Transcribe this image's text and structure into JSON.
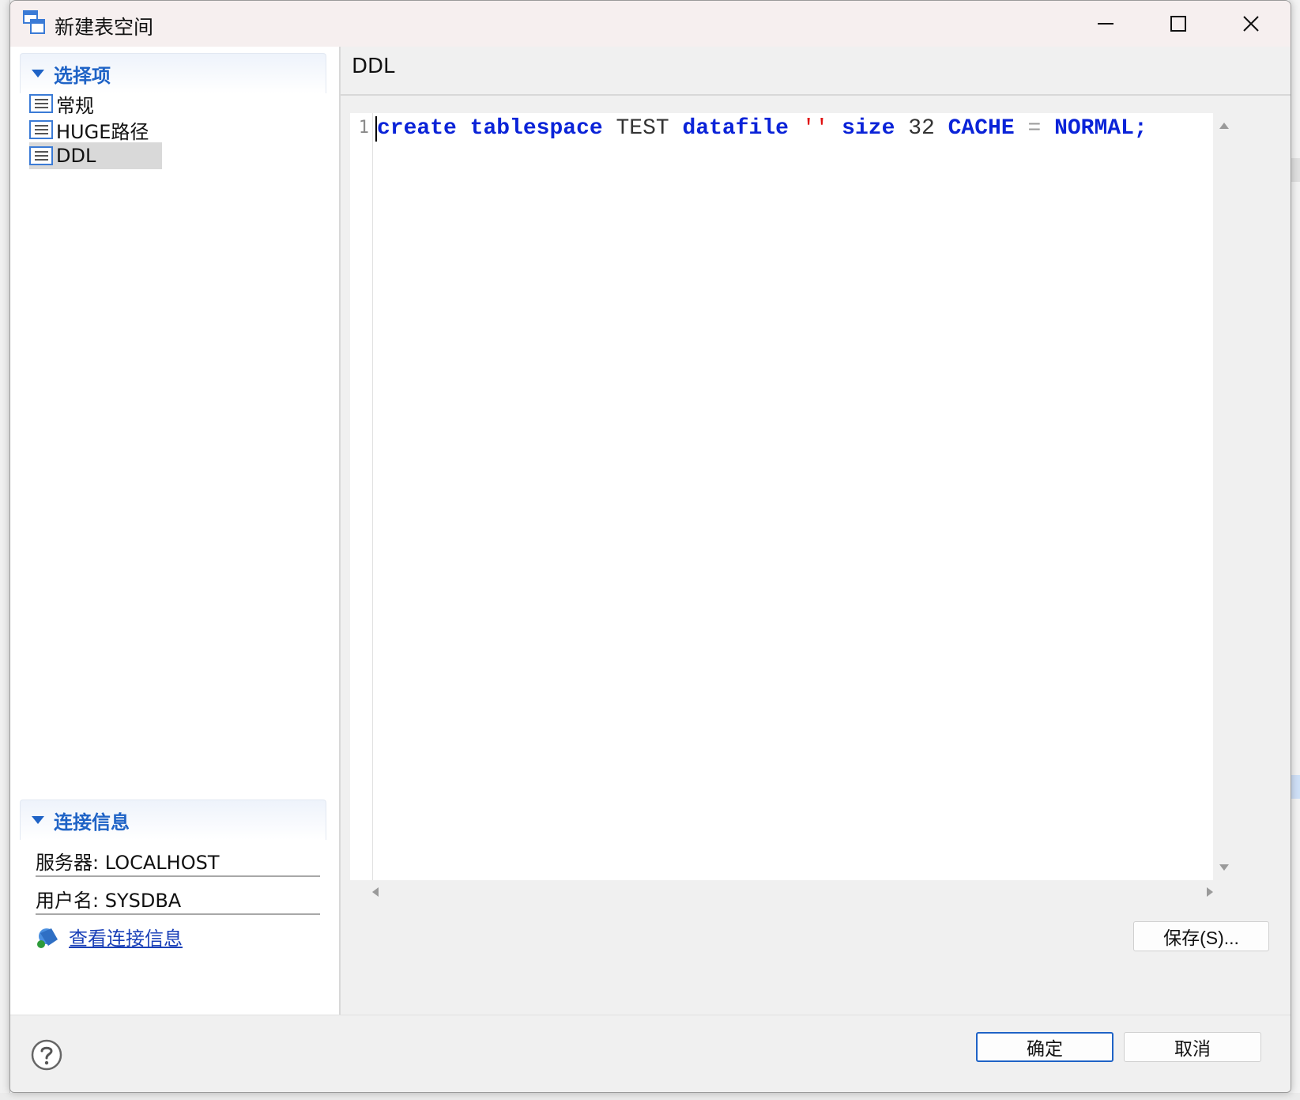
{
  "window": {
    "title": "新建表空间",
    "icon": "tablespace-app-icon",
    "controls": [
      "minimize-icon",
      "maximize-icon",
      "close-icon"
    ]
  },
  "left": {
    "options_section": {
      "title": "选择项",
      "items": [
        {
          "label": "常规",
          "icon": "list-page-icon"
        },
        {
          "label": "HUGE路径",
          "icon": "list-page-icon"
        },
        {
          "label": "DDL",
          "icon": "list-page-icon",
          "selected": true
        }
      ]
    },
    "connection_section": {
      "title": "连接信息",
      "server": "服务器: LOCALHOST",
      "username": "用户名: SYSDBA",
      "view_link": "查看连接信息",
      "view_link_icon": "connection-info-icon"
    }
  },
  "right": {
    "header": "DDL",
    "editor": {
      "line_number": "1",
      "tokens": {
        "t1": "create",
        "t2": "tablespace",
        "t3": "TEST",
        "t4": "datafile",
        "t5": "''",
        "t6": "size",
        "t7": "32",
        "t8": "CACHE",
        "t9": "=",
        "t10": "NORMAL;"
      }
    },
    "save_button": "保存(S)..."
  },
  "footer": {
    "help_icon": "help-question-icon",
    "ok_button": "确定",
    "cancel_button": "取消"
  },
  "colors": {
    "keyword": "#0a23d8",
    "string": "#e01010",
    "section_title": "#1f63c6",
    "link": "#1a40b8"
  }
}
